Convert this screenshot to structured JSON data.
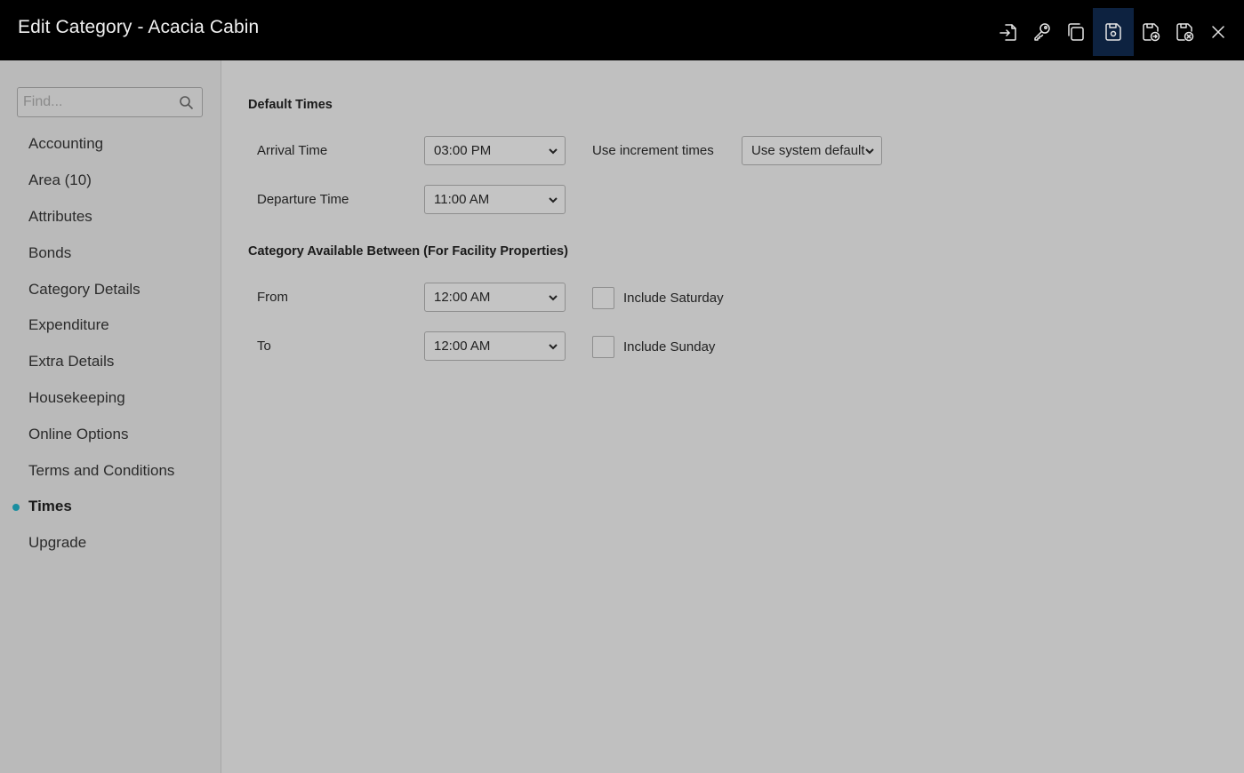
{
  "window": {
    "title": "Edit Category - Acacia Cabin"
  },
  "toolbar": {
    "buttons": [
      {
        "name": "import-icon"
      },
      {
        "name": "key-icon"
      },
      {
        "name": "copy-icon"
      },
      {
        "name": "save-icon",
        "active": true
      },
      {
        "name": "save-and-continue-icon"
      },
      {
        "name": "save-and-close-icon"
      },
      {
        "name": "close-icon"
      }
    ]
  },
  "sidebar": {
    "search_placeholder": "Find...",
    "items": [
      {
        "label": "Accounting"
      },
      {
        "label": "Area (10)"
      },
      {
        "label": "Attributes"
      },
      {
        "label": "Bonds"
      },
      {
        "label": "Category Details"
      },
      {
        "label": "Expenditure"
      },
      {
        "label": "Extra Details"
      },
      {
        "label": "Housekeeping"
      },
      {
        "label": "Online Options"
      },
      {
        "label": "Terms and Conditions"
      },
      {
        "label": "Times",
        "active": true
      },
      {
        "label": "Upgrade"
      }
    ]
  },
  "default_times": {
    "title": "Default Times",
    "arrival_label": "Arrival Time",
    "arrival_value": "03:00 PM",
    "increment_label": "Use increment times",
    "increment_value": "Use system default",
    "departure_label": "Departure Time",
    "departure_value": "11:00 AM"
  },
  "availability": {
    "title": "Category Available Between (For Facility Properties)",
    "from_label": "From",
    "from_value": "12:00 AM",
    "to_label": "To",
    "to_value": "12:00 AM",
    "include_saturday_label": "Include Saturday",
    "include_saturday_checked": false,
    "include_sunday_label": "Include Sunday",
    "include_sunday_checked": false
  },
  "colors": {
    "header_bg": "#000000",
    "active_button_bg": "#0d2240",
    "accent_dot": "#1a8ea0",
    "background": "#c0c0c0"
  }
}
